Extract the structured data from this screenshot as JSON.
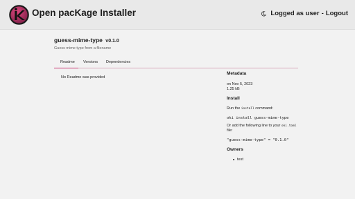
{
  "header": {
    "app_title": "Open pacKage Installer",
    "user_status": "Logged as user",
    "separator": "-",
    "logout_label": "Logout",
    "brand_color": "#c8336e",
    "icons": [
      "logo-k-icon",
      "moon-icon"
    ]
  },
  "package": {
    "name": "guess-mime-type",
    "version": "v0.1.0",
    "description": "Guess mime type from a filename"
  },
  "tabs": [
    {
      "label": "Readme",
      "active": true
    },
    {
      "label": "Versions",
      "active": false
    },
    {
      "label": "Dependencies",
      "active": false
    }
  ],
  "readme": {
    "content": "No Readme was provided"
  },
  "sidebar": {
    "metadata_title": "Metadata",
    "date": "on Nov 5, 2023",
    "size": "1.25 kB",
    "install_title": "Install",
    "run_prefix": "Run the ",
    "run_command": "install",
    "run_suffix": " command:",
    "install_command": "oki install guess-mime-type",
    "add_prefix": "Or add the following line to your ",
    "add_file": "oki.toml",
    "add_suffix": "file:",
    "dependency_line": "\"guess-mime-type\" = \"0.1.0\"",
    "owners_title": "Owners",
    "owners": [
      "test"
    ]
  }
}
